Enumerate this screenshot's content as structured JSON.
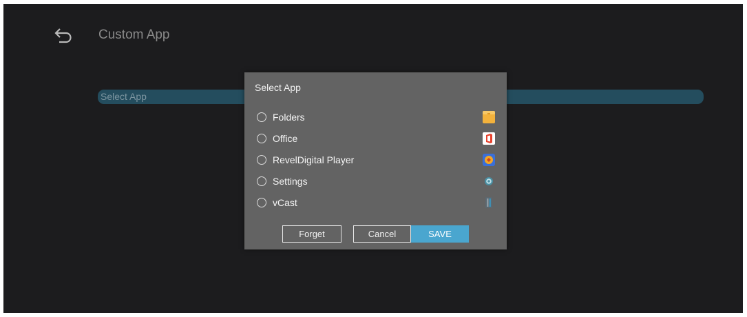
{
  "page": {
    "title": "Custom App"
  },
  "select_row": {
    "label": "Select App"
  },
  "dialog": {
    "title": "Select App",
    "options": [
      {
        "label": "Folders",
        "icon": "folder-icon",
        "icon_color": "#f3b23c"
      },
      {
        "label": "Office",
        "icon": "office-icon",
        "icon_color": "#e8412c"
      },
      {
        "label": "RevelDigital Player",
        "icon": "reveldigital-icon",
        "icon_color": "#3a6fd8"
      },
      {
        "label": "Settings",
        "icon": "settings-gear-icon",
        "icon_color": "#bfe0e8"
      },
      {
        "label": "vCast",
        "icon": "vcast-icon",
        "icon_color": "#7b8790"
      }
    ],
    "buttons": {
      "forget": "Forget",
      "cancel": "Cancel",
      "save": "SAVE"
    }
  },
  "colors": {
    "background": "#1c1c1e",
    "dialog": "#636363",
    "accent": "#4aa6cf",
    "selection_row": "#244d5e"
  }
}
